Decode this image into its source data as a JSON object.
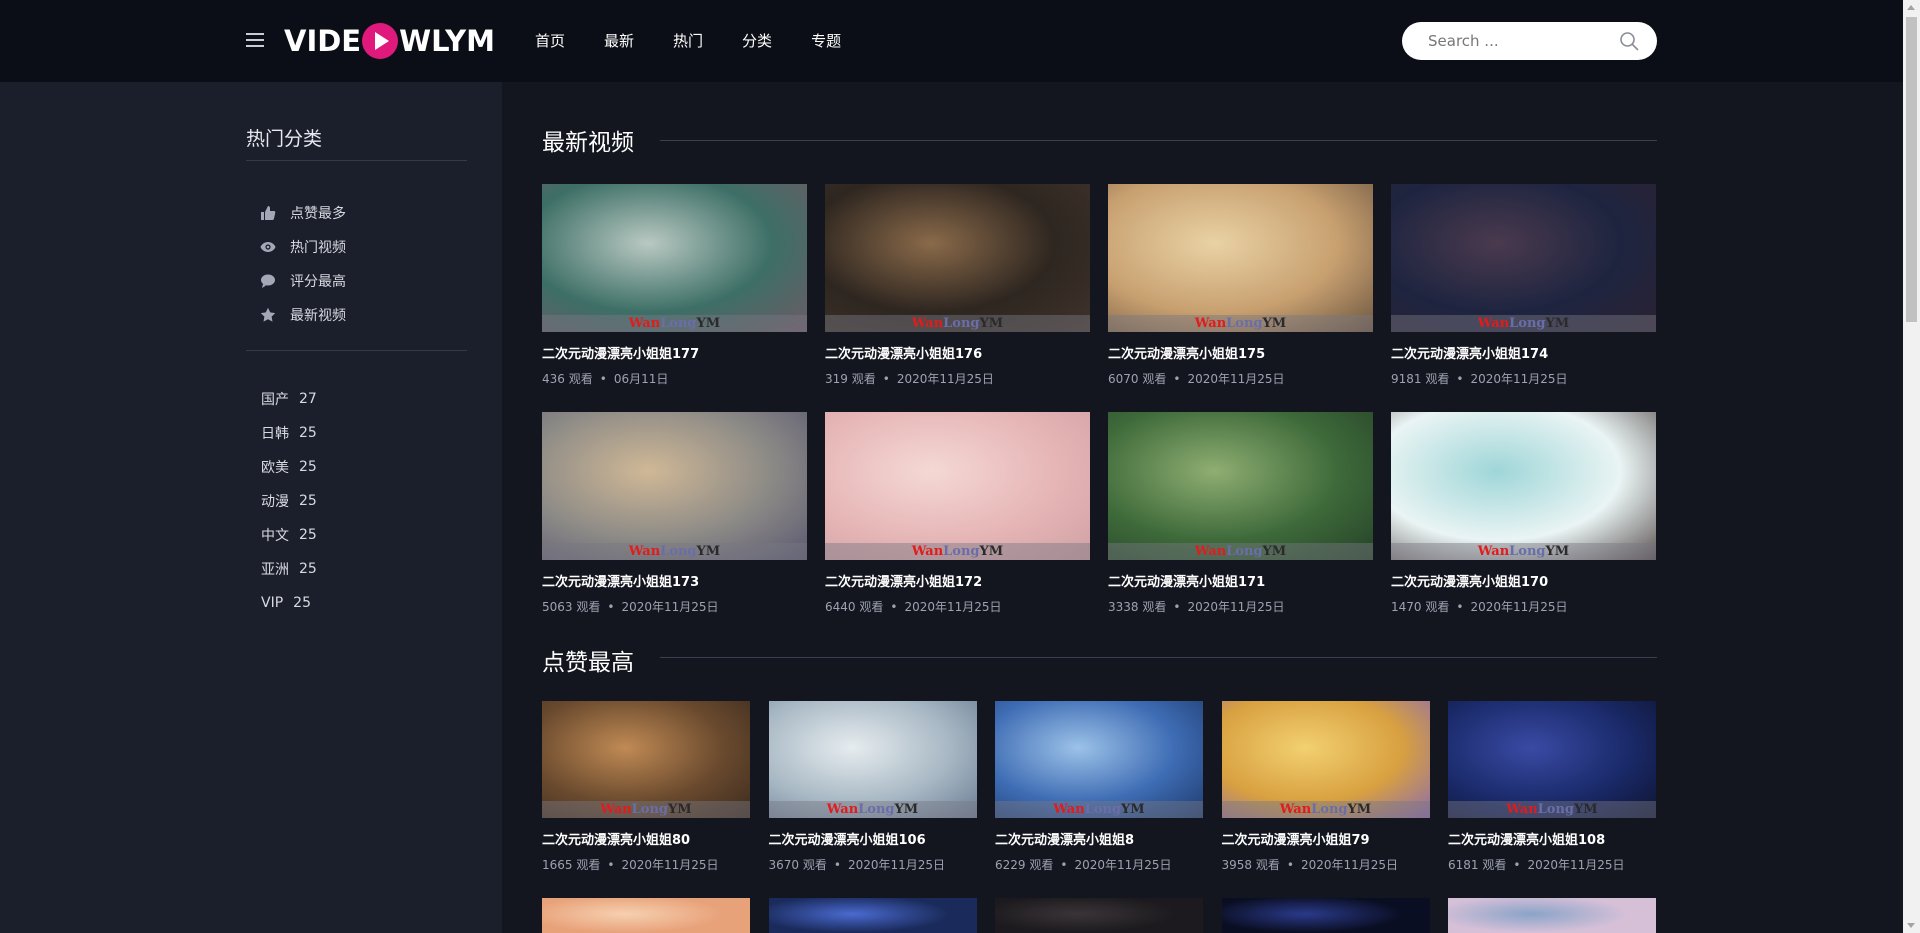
{
  "header": {
    "logo_left": "VIDE",
    "logo_right": "WLYM",
    "nav": [
      "首页",
      "最新",
      "热门",
      "分类",
      "专题"
    ],
    "search_placeholder": "Search ..."
  },
  "sidebar": {
    "title": "热门分类",
    "links": [
      {
        "icon": "thumbs-up-icon",
        "label": "点赞最多"
      },
      {
        "icon": "eye-icon",
        "label": "热门视频"
      },
      {
        "icon": "comment-icon",
        "label": "评分最高"
      },
      {
        "icon": "star-icon",
        "label": "最新视频"
      }
    ],
    "categories": [
      {
        "name": "国产",
        "count": "27"
      },
      {
        "name": "日韩",
        "count": "25"
      },
      {
        "name": "欧美",
        "count": "25"
      },
      {
        "name": "动漫",
        "count": "25"
      },
      {
        "name": "中文",
        "count": "25"
      },
      {
        "name": "亚洲",
        "count": "25"
      },
      {
        "name": "VIP",
        "count": "25"
      }
    ]
  },
  "sections": {
    "latest": {
      "title": "最新视频",
      "items": [
        {
          "title": "二次元动漫漂亮小姐姐177",
          "views": "436 观看",
          "date": "06月11日",
          "colors": [
            "#3d6f66",
            "#b9c9c2",
            "#6e5a66"
          ]
        },
        {
          "title": "二次元动漫漂亮小姐姐176",
          "views": "319 观看",
          "date": "2020年11月25日",
          "colors": [
            "#2e2620",
            "#8a6a4a",
            "#40342c"
          ]
        },
        {
          "title": "二次元动漫漂亮小姐姐175",
          "views": "6070 观看",
          "date": "2020年11月25日",
          "colors": [
            "#c8a070",
            "#e9d2a4",
            "#6b5540"
          ]
        },
        {
          "title": "二次元动漫漂亮小姐姐174",
          "views": "9181 观看",
          "date": "2020年11月25日",
          "colors": [
            "#1e2440",
            "#4a3a4e",
            "#2b2232"
          ]
        },
        {
          "title": "二次元动漫漂亮小姐姐173",
          "views": "5063 观看",
          "date": "2020年11月25日",
          "colors": [
            "#8c8a86",
            "#d0b896",
            "#5a5870"
          ]
        },
        {
          "title": "二次元动漫漂亮小姐姐172",
          "views": "6440 观看",
          "date": "2020年11月25日",
          "colors": [
            "#e6b6b6",
            "#f4d8d4",
            "#cfa0a4"
          ]
        },
        {
          "title": "二次元动漫漂亮小姐姐171",
          "views": "3338 观看",
          "date": "2020年11月25日",
          "colors": [
            "#3e6a3a",
            "#8fae72",
            "#254228"
          ]
        },
        {
          "title": "二次元动漫漂亮小姐姐170",
          "views": "1470 观看",
          "date": "2020年11月25日",
          "colors": [
            "#eaf4f4",
            "#9fd6d8",
            "#5a5050"
          ]
        }
      ]
    },
    "top": {
      "title": "点赞最高",
      "items": [
        {
          "title": "二次元动漫漂亮小姐姐80",
          "views": "1665 观看",
          "date": "2020年11月25日",
          "colors": [
            "#6a4a2e",
            "#c08a54",
            "#3a2a1e"
          ]
        },
        {
          "title": "二次元动漫漂亮小姐姐106",
          "views": "3670 观看",
          "date": "2020年11月25日",
          "colors": [
            "#a8b8c4",
            "#e6ecef",
            "#6a7c94"
          ]
        },
        {
          "title": "二次元动漫漂亮小姐姐8",
          "views": "6229 观看",
          "date": "2020年11月25日",
          "colors": [
            "#3e6cb4",
            "#9cc2e8",
            "#1e3a6c"
          ]
        },
        {
          "title": "二次元动漫漂亮小姐姐79",
          "views": "3958 观看",
          "date": "2020年11月25日",
          "colors": [
            "#d8a040",
            "#f2d070",
            "#8a6ab0"
          ]
        },
        {
          "title": "二次元动漫漂亮小姐姐108",
          "views": "6181 观看",
          "date": "2020年11月25日",
          "colors": [
            "#1a2a6a",
            "#3a4aa4",
            "#0e1430"
          ]
        }
      ],
      "next_row_colors": [
        [
          "#e8a27a",
          "#f6d0b0"
        ],
        [
          "#1a2a5a",
          "#4a6ad0"
        ],
        [
          "#1c1a1e",
          "#3a3438"
        ],
        [
          "#0a0e22",
          "#2a3a8a"
        ],
        [
          "#d6c0d8",
          "#8aa4c8"
        ]
      ]
    },
    "watermark": {
      "red": "Wan",
      "mid": "Long",
      "tail": "YM"
    }
  },
  "colors": {
    "background": "#13161f",
    "header": "#0b0e16",
    "sidebar": "#1b1f2b",
    "accent": "#e0197d"
  }
}
